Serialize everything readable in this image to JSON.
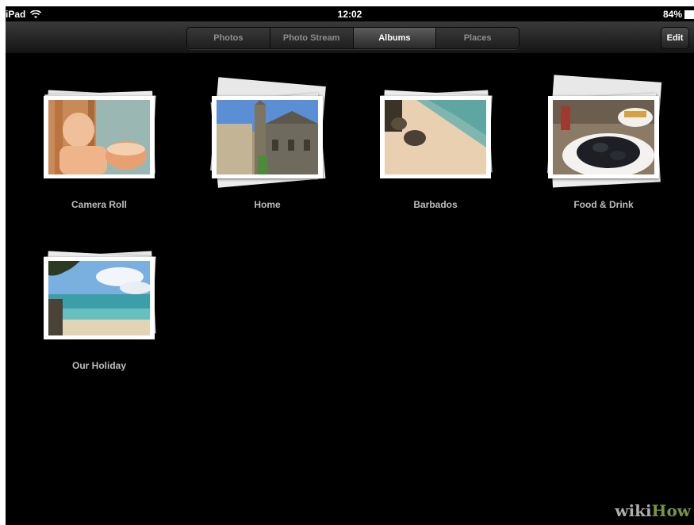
{
  "status": {
    "device": "iPad",
    "time": "12:02",
    "battery": "84%"
  },
  "navbar": {
    "tabs": [
      {
        "label": "Photos",
        "active": false
      },
      {
        "label": "Photo Stream",
        "active": false
      },
      {
        "label": "Albums",
        "active": true
      },
      {
        "label": "Places",
        "active": false
      }
    ],
    "edit_label": "Edit"
  },
  "albums": [
    {
      "name": "Camera Roll"
    },
    {
      "name": "Home"
    },
    {
      "name": "Barbados"
    },
    {
      "name": "Food & Drink"
    },
    {
      "name": "Our Holiday"
    }
  ],
  "watermark": {
    "part1": "wiki",
    "part2": "How"
  }
}
